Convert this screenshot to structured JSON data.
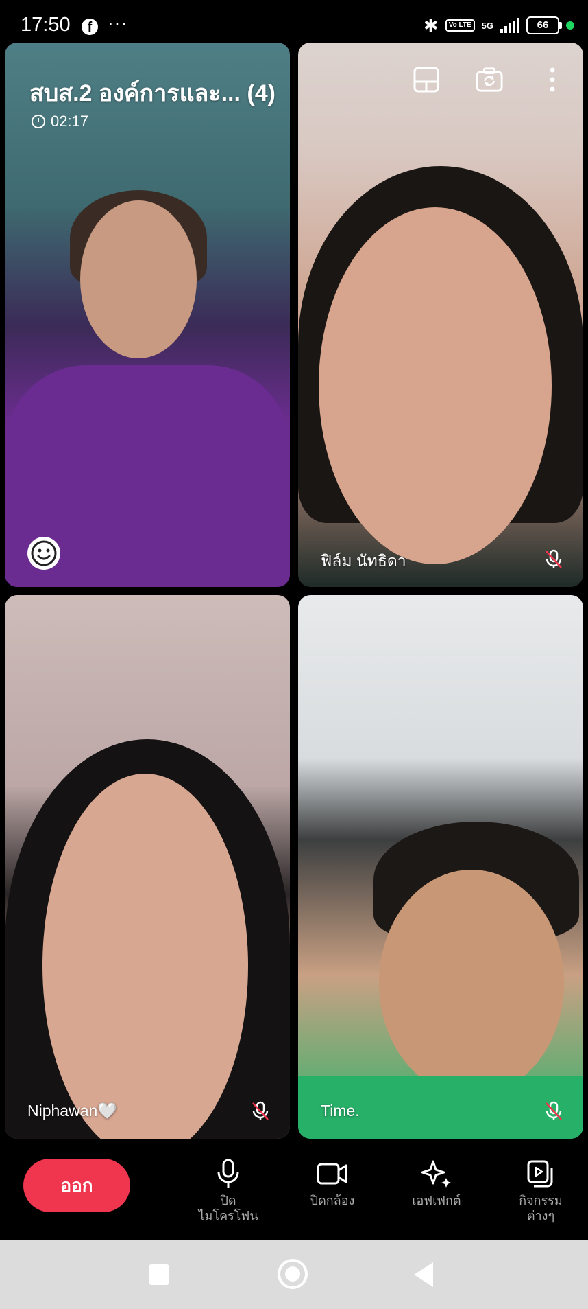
{
  "status_bar": {
    "time": "17:50",
    "app_icon": "facebook-icon",
    "more": "···",
    "volte": "Vo LTE",
    "network": "5G",
    "battery": "66",
    "battery_level": 0.66,
    "indicator_color": "#1ed760"
  },
  "call": {
    "title": "สบส.2 องค์การและ... (4)",
    "timer": "02:17"
  },
  "participants": [
    {
      "name": "",
      "muted": false
    },
    {
      "name": "ฟิล์ม นัทธิดา",
      "muted": true
    },
    {
      "name": "Niphawan🤍",
      "muted": true
    },
    {
      "name": "Time.",
      "muted": true
    }
  ],
  "top_actions": [
    "layout-icon",
    "switch-camera-icon",
    "more-vertical-icon"
  ],
  "controls": {
    "leave": "ออก",
    "mic_line1": "ปิด",
    "mic_line2": "ไมโครโฟน",
    "camera": "ปิดกล้อง",
    "effects": "เอฟเฟกต์",
    "activities_line1": "กิจกรรม",
    "activities_line2": "ต่างๆ"
  },
  "colors": {
    "leave_button": "#f0364f",
    "navbar": "#dcdcdc"
  }
}
